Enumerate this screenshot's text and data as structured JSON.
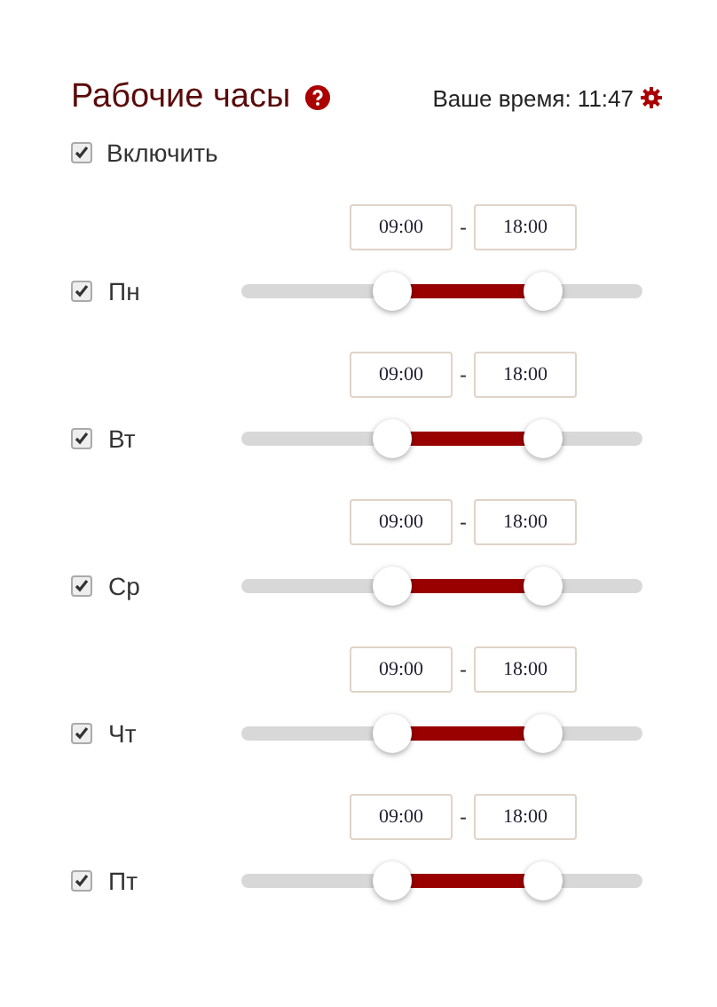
{
  "title": "Рабочие часы",
  "your_time": "Ваше время: 11:47",
  "enable": {
    "label": "Включить",
    "checked": true
  },
  "days": [
    {
      "label": "Пн",
      "checked": true,
      "start": "09:00",
      "end": "18:00",
      "separator": "-",
      "thumbs": [
        {
          "level": 0.375
        },
        {
          "level": 0.75
        }
      ]
    },
    {
      "label": "Вт",
      "checked": true,
      "start": "09:00",
      "end": "18:00",
      "separator": "-",
      "thumbs": [
        {
          "level": 0.375
        },
        {
          "level": 0.75
        }
      ]
    },
    {
      "label": "Ср",
      "checked": true,
      "start": "09:00",
      "end": "18:00",
      "separator": "-",
      "thumbs": [
        {
          "level": 0.375
        },
        {
          "level": 0.75
        }
      ]
    },
    {
      "label": "Чт",
      "checked": true,
      "start": "09:00",
      "end": "18:00",
      "separator": "-",
      "thumbs": [
        {
          "level": 0.375
        },
        {
          "level": 0.75
        }
      ]
    },
    {
      "label": "Пт",
      "checked": true,
      "start": "09:00",
      "end": "18:00",
      "separator": "-",
      "thumbs": [
        {
          "level": 0.375
        },
        {
          "level": 0.75
        }
      ]
    }
  ]
}
